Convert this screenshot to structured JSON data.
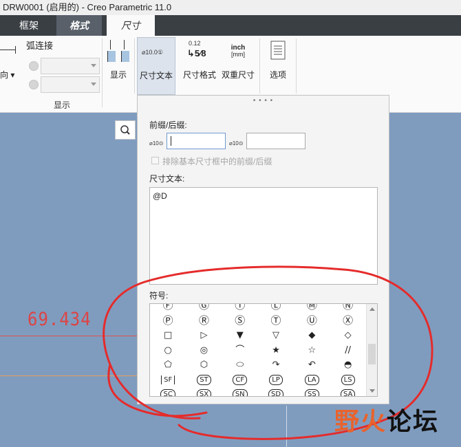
{
  "window": {
    "title": "DRW0001 (启用的) - Creo Parametric 11.0"
  },
  "ribbon": {
    "tabs": [
      "框架",
      "格式",
      "尺寸"
    ],
    "arc_label": "弧连接",
    "direction_label": "向 ▾",
    "display_group_label": "显示",
    "buttons": {
      "display": "显示",
      "dim_text": "尺寸文本",
      "dim_format": "尺寸格式",
      "dual_dim": "双重尺寸",
      "options": "选项"
    },
    "icons": {
      "dim_text_sample": "⌀10.0①",
      "format_top": "0.12",
      "format_bottom": "5⁄8",
      "inch": "inch",
      "mm": "[mm]"
    }
  },
  "workspace": {
    "dimension_value": "69.434",
    "colors": {
      "dim": "#d44444",
      "line_red": "#e35050",
      "line_orange": "#e8a05a",
      "background": "#7f9cbf"
    }
  },
  "panel": {
    "prefix_suffix_label": "前缀/后缀:",
    "prefix_icon": "⌀10⊙",
    "suffix_icon": "⌀10⊙",
    "prefix_value": "",
    "suffix_value": "",
    "exclude_checkbox_label": "排除基本尺寸框中的前缀/后缀",
    "dim_text_label": "尺寸文本:",
    "dim_text_value": "@D",
    "symbols_label": "符号:",
    "symbols": [
      "Ⓕ",
      "Ⓖ",
      "Ⓘ",
      "Ⓛ",
      "Ⓜ",
      "Ⓝ",
      "Ⓟ",
      "Ⓡ",
      "Ⓢ",
      "Ⓣ",
      "Ⓤ",
      "Ⓧ",
      "□",
      "▷",
      "▼",
      "▽",
      "◆",
      "◇",
      "○",
      "◎",
      "⌒",
      "★",
      "☆",
      "//",
      "⬠",
      "⬡",
      "⬭",
      "↷",
      "↶",
      "◓",
      "SF",
      "ST",
      "CF",
      "LP",
      "LA",
      "LS",
      "SC",
      "SX",
      "SN",
      "SD",
      "SS",
      "SA"
    ]
  },
  "watermark": {
    "part1": "野火",
    "part2": "论坛"
  }
}
